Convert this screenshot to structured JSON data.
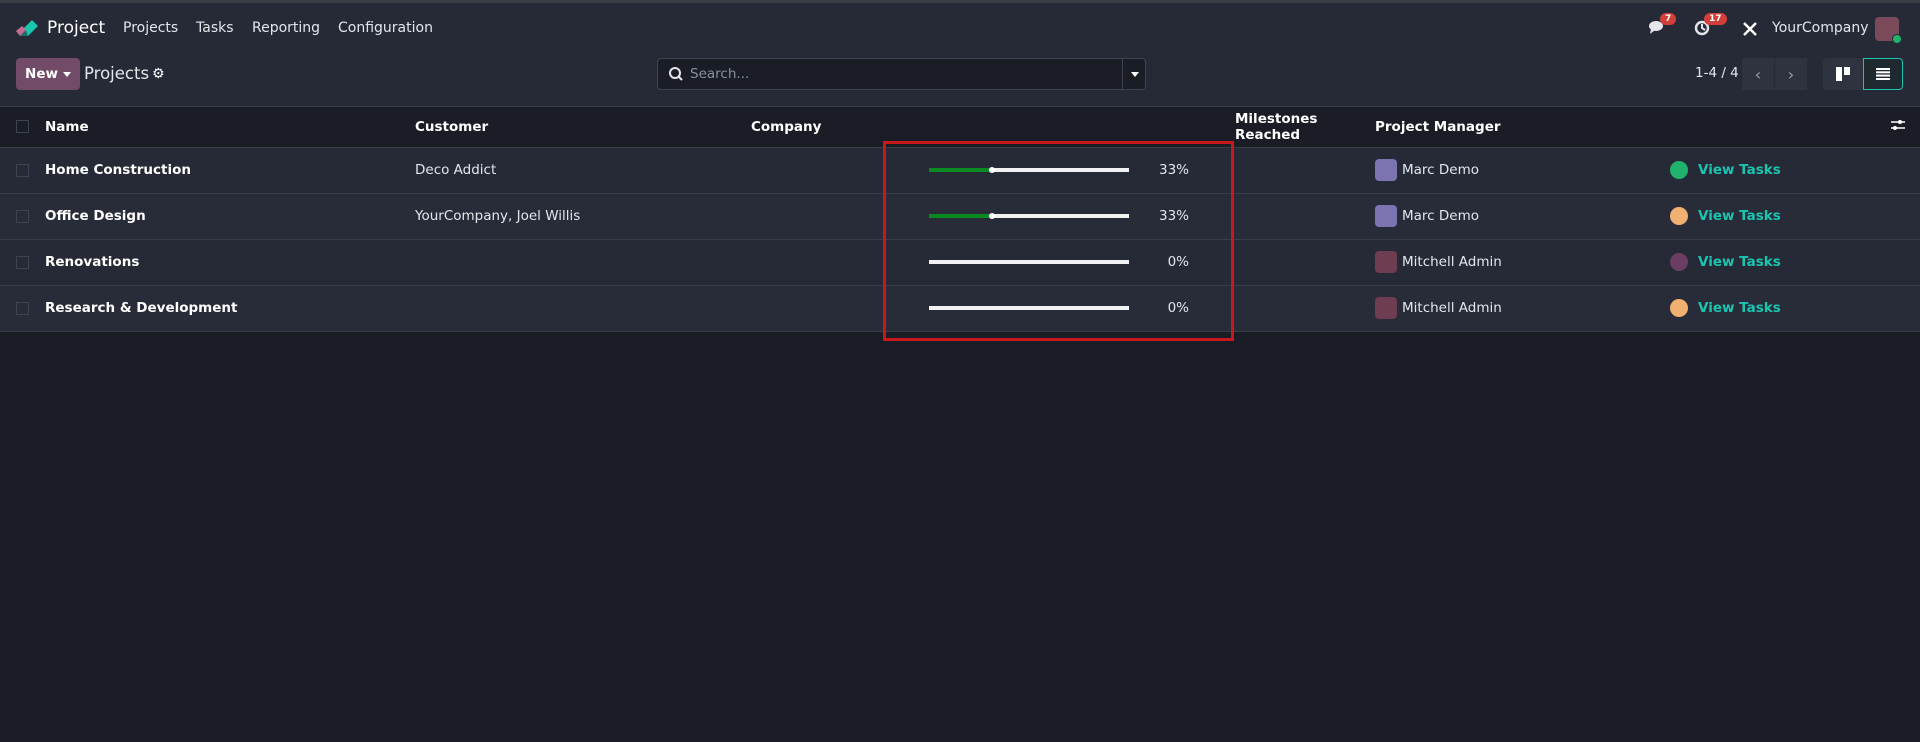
{
  "navbar": {
    "app_name": "Project",
    "menu": [
      "Projects",
      "Tasks",
      "Reporting",
      "Configuration"
    ],
    "messages_count": "7",
    "activities_count": "17",
    "company": "YourCompany"
  },
  "control": {
    "new_label": "New",
    "breadcrumb": "Projects",
    "search_placeholder": "Search...",
    "pager": "1-4 / 4"
  },
  "table": {
    "headers": {
      "name": "Name",
      "customer": "Customer",
      "company": "Company",
      "milestones": "Milestones Reached",
      "manager": "Project Manager"
    },
    "rows": [
      {
        "name": "Home Construction",
        "customer": "Deco Addict",
        "company": "",
        "milestone_progress": 33,
        "milestone_label": "33%",
        "manager": "Marc Demo",
        "status_color": "#21b26d",
        "action": "View Tasks"
      },
      {
        "name": "Office Design",
        "customer": "YourCompany, Joel Willis",
        "company": "",
        "milestone_progress": 33,
        "milestone_label": "33%",
        "manager": "Marc Demo",
        "status_color": "#f0b070",
        "action": "View Tasks"
      },
      {
        "name": "Renovations",
        "customer": "",
        "company": "",
        "milestone_progress": 0,
        "milestone_label": "0%",
        "manager": "Mitchell Admin",
        "status_color": "#6b3d64",
        "action": "View Tasks"
      },
      {
        "name": "Research & Development",
        "customer": "",
        "company": "",
        "milestone_progress": 0,
        "milestone_label": "0%",
        "manager": "Mitchell Admin",
        "status_color": "#f0b070",
        "action": "View Tasks"
      }
    ]
  },
  "colors": {
    "accent": "#714b67",
    "link": "#1ac5b0",
    "highlight": "#c8181c"
  }
}
